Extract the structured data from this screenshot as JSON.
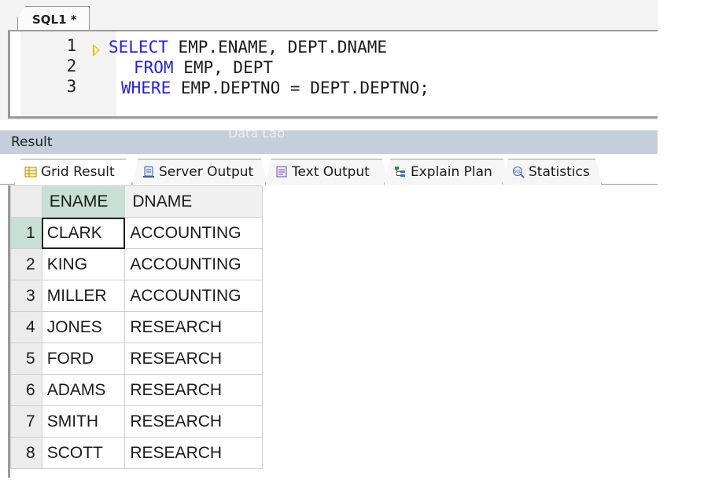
{
  "editor": {
    "tab_label": "SQL1 *",
    "line_numbers": [
      "1",
      "2",
      "3"
    ],
    "lines": [
      {
        "keyword": "SELECT",
        "rest": " EMP.ENAME, DEPT.DNAME"
      },
      {
        "keyword": "FROM",
        "rest": " EMP, DEPT"
      },
      {
        "keyword": "WHERE",
        "rest": " EMP.DEPTNO = DEPT.DEPTNO;"
      }
    ]
  },
  "watermark": "Data Lab",
  "result": {
    "header_label": "Result",
    "tabs": [
      {
        "label": "Grid Result",
        "icon": "grid-icon"
      },
      {
        "label": "Server Output",
        "icon": "server-icon"
      },
      {
        "label": "Text Output",
        "icon": "text-output-icon"
      },
      {
        "label": "Explain Plan",
        "icon": "explain-plan-icon"
      },
      {
        "label": "Statistics",
        "icon": "statistics-icon"
      }
    ],
    "grid": {
      "columns": [
        "ENAME",
        "DNAME"
      ],
      "rows": [
        {
          "num": "1",
          "ename": "CLARK",
          "dname": "ACCOUNTING"
        },
        {
          "num": "2",
          "ename": "KING",
          "dname": "ACCOUNTING"
        },
        {
          "num": "3",
          "ename": "MILLER",
          "dname": "ACCOUNTING"
        },
        {
          "num": "4",
          "ename": "JONES",
          "dname": "RESEARCH"
        },
        {
          "num": "5",
          "ename": "FORD",
          "dname": "RESEARCH"
        },
        {
          "num": "6",
          "ename": "ADAMS",
          "dname": "RESEARCH"
        },
        {
          "num": "7",
          "ename": "SMITH",
          "dname": "RESEARCH"
        },
        {
          "num": "8",
          "ename": "SCOTT",
          "dname": "RESEARCH"
        }
      ]
    }
  },
  "colors": {
    "keyword": "#2323e0",
    "header_band": "#c4cfdb",
    "selection_accent": "#c8e0d4"
  }
}
